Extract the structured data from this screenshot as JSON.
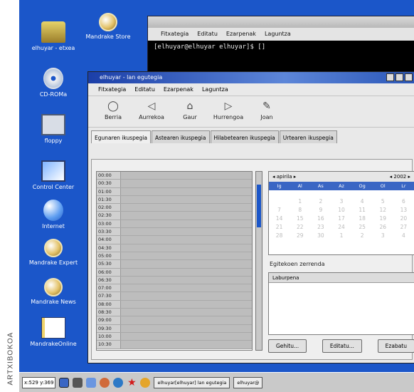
{
  "credit": "ARTXIBOKOA",
  "desktop": {
    "icons": [
      {
        "label": "elhuyar - etxea",
        "icon": "home-icon"
      },
      {
        "label": "CD-ROMa",
        "icon": "cdrom-icon"
      },
      {
        "label": "floppy",
        "icon": "floppy-icon"
      },
      {
        "label": "Control Center",
        "icon": "control-center-icon"
      },
      {
        "label": "Internet",
        "icon": "internet-icon"
      },
      {
        "label": "Mandrake Expert",
        "icon": "expert-icon"
      },
      {
        "label": "Mandrake News",
        "icon": "news-icon"
      },
      {
        "label": "MandrakeOnline",
        "icon": "online-icon"
      }
    ],
    "top_icon_label": "Mandrake Store"
  },
  "terminal": {
    "menu": [
      "Fitxategia",
      "Editatu",
      "Ezarpenak",
      "Laguntza"
    ],
    "prompt": "[elhuyar@elhuyar elhuyar]$ []"
  },
  "window": {
    "title": "elhuyar - lan egutegia",
    "menu": [
      "Fitxategia",
      "Editatu",
      "Ezarpenak",
      "Laguntza"
    ],
    "toolbar": [
      {
        "label": "Berria",
        "glyph": "◯"
      },
      {
        "label": "Aurrekoa",
        "glyph": "◁"
      },
      {
        "label": "Gaur",
        "glyph": "⌂"
      },
      {
        "label": "Hurrengoa",
        "glyph": "▷"
      },
      {
        "label": "Joan",
        "glyph": "✎"
      }
    ],
    "tabs": [
      "Egunaren ikuspegia",
      "Astearen ikuspegia",
      "Hilabetearen ikuspegia",
      "Urtearen ikuspegia"
    ],
    "time_slots": [
      "00:00",
      "00:30",
      "01:00",
      "01:30",
      "02:00",
      "02:30",
      "03:00",
      "03:30",
      "04:00",
      "04:30",
      "05:00",
      "05:30",
      "06:00",
      "06:30",
      "07:00",
      "07:30",
      "08:00",
      "08:30",
      "09:00",
      "09:30",
      "10:00",
      "10:30"
    ],
    "calendar": {
      "month": "apirila",
      "year": "2002",
      "weekdays": [
        "Ig",
        "Al",
        "As",
        "Az",
        "Og",
        "Ol",
        "Lr"
      ],
      "days": [
        "",
        "1",
        "2",
        "3",
        "4",
        "5",
        "6",
        "7",
        "8",
        "9",
        "10",
        "11",
        "12",
        "13",
        "14",
        "15",
        "16",
        "17",
        "18",
        "19",
        "20",
        "21",
        "22",
        "23",
        "24",
        "25",
        "26",
        "27",
        "28",
        "29",
        "30",
        "1",
        "2",
        "3",
        "4"
      ],
      "selected_day": "10"
    },
    "todo_label": "Egitekoen zerrenda",
    "todo_header": "Laburpena",
    "buttons": [
      "Gehitu...",
      "Editatu...",
      "Ezabatu"
    ]
  },
  "taskbar": {
    "coords": "x:529 y:369",
    "tasks": [
      "elhuyar[elhuyar] lan egutegia",
      "elhuyar@"
    ]
  }
}
